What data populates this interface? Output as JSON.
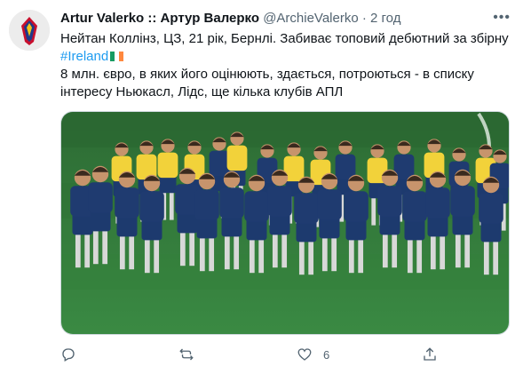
{
  "tweet": {
    "display_name": "Artur Valerko :: Артур Валерко",
    "handle": "@ArchieValerko",
    "separator": "·",
    "timestamp": "2 год",
    "text_line1": "Нейтан Коллінз, ЦЗ, 21 рік, Бернлі. Забиває топовий дебютний за збірну",
    "hashtag": "#Ireland",
    "text_paragraph2": "8 млн. євро, в яких його оцінюють, здається, потроються - в списку інтересу Ньюкасл, Лідс, ще кілька клубів АПЛ",
    "flag_colors": [
      "#169b62",
      "#ffffff",
      "#ff883e"
    ],
    "more_icon": "more-dots-icon",
    "media_description_icon": "photo-team-huddle"
  },
  "actions": {
    "reply_icon": "reply-icon",
    "retweet_icon": "retweet-icon",
    "like_icon": "heart-icon",
    "like_count": "6",
    "share_icon": "share-icon"
  },
  "colors": {
    "text": "#0f1419",
    "secondary": "#536471",
    "link": "#1d9bf0",
    "pitch": "#2f7d3a"
  }
}
